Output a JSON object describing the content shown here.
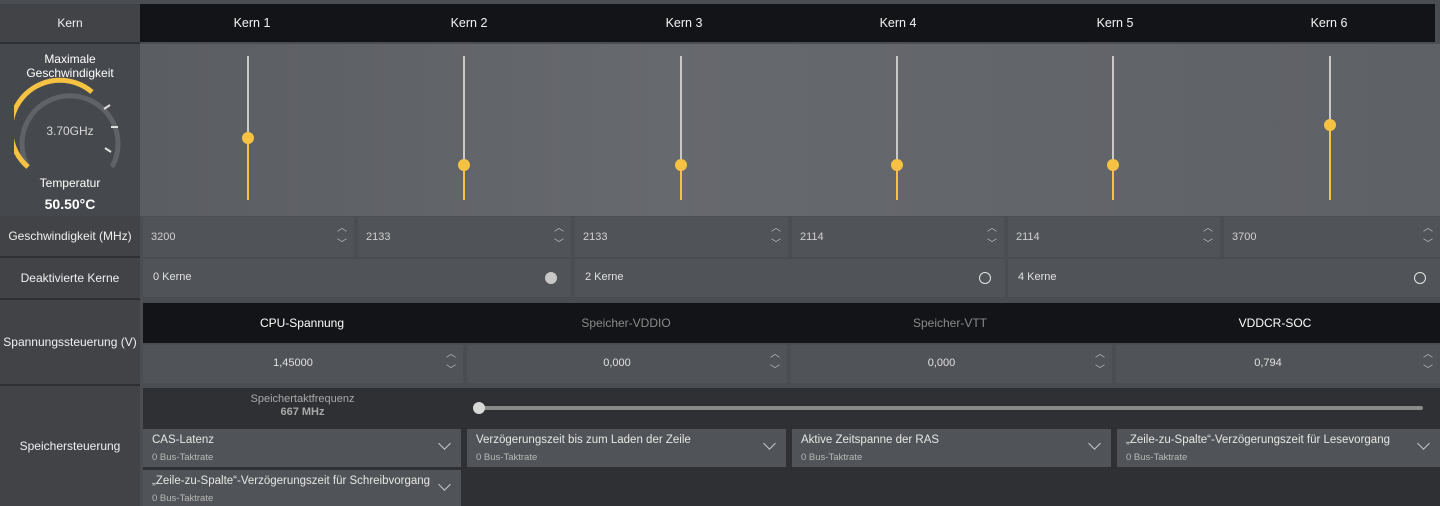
{
  "header": {
    "kern_label": "Kern"
  },
  "cores": [
    {
      "name": "Kern 1",
      "speed": "3200",
      "slider_level": 0.43
    },
    {
      "name": "Kern 2",
      "speed": "2133",
      "slider_level": 0.24
    },
    {
      "name": "Kern 3",
      "speed": "2133",
      "slider_level": 0.24
    },
    {
      "name": "Kern 4",
      "speed": "2114",
      "slider_level": 0.24
    },
    {
      "name": "Kern 5",
      "speed": "2114",
      "slider_level": 0.24
    },
    {
      "name": "Kern 6",
      "speed": "3700",
      "slider_level": 0.52
    }
  ],
  "gauge": {
    "title": "Maximale Geschwindigkeit",
    "value": "3.70GHz",
    "temp_label": "Temperatur",
    "temp_value": "50.50°C"
  },
  "rows": {
    "speed_label": "Geschwindigkeit (MHz)",
    "disabled_label": "Deaktivierte Kerne",
    "voltage_label": "Spannungssteuerung (V)",
    "memory_label": "Speichersteuerung"
  },
  "disabled_cores": [
    {
      "label": "0 Kerne",
      "selected": true
    },
    {
      "label": "2 Kerne",
      "selected": false
    },
    {
      "label": "4 Kerne",
      "selected": false
    }
  ],
  "voltage": [
    {
      "name": "CPU-Spannung",
      "value": "1,45000",
      "active": true
    },
    {
      "name": "Speicher-VDDIO",
      "value": "0,000",
      "active": false
    },
    {
      "name": "Speicher-VTT",
      "value": "0,000",
      "active": false
    },
    {
      "name": "VDDCR-SOC",
      "value": "0,794",
      "active": true
    }
  ],
  "memory": {
    "freq_label": "Speichertaktfrequenz",
    "freq_value": "667 MHz",
    "freq_slider_level": 0.0,
    "dropdowns": [
      {
        "title": "CAS-Latenz",
        "sub": "0 Bus-Taktrate"
      },
      {
        "title": "Verzögerungszeit bis zum Laden der Zeile",
        "sub": "0 Bus-Taktrate"
      },
      {
        "title": "Aktive Zeitspanne der RAS",
        "sub": "0 Bus-Taktrate"
      },
      {
        "title": "„Zeile-zu-Spalte“-Verzögerungszeit für Lesevorgang",
        "sub": "0 Bus-Taktrate"
      },
      {
        "title": "„Zeile-zu-Spalte“-Verzögerungszeit für Schreibvorgang",
        "sub": "0 Bus-Taktrate"
      }
    ]
  },
  "colors": {
    "accent": "#f5c242",
    "header_bg": "#121417",
    "panel_bg": "#505357"
  },
  "icons": {
    "spin_up": "chevron-up-icon",
    "spin_down": "chevron-down-icon",
    "dropdown": "chevron-down-icon"
  }
}
